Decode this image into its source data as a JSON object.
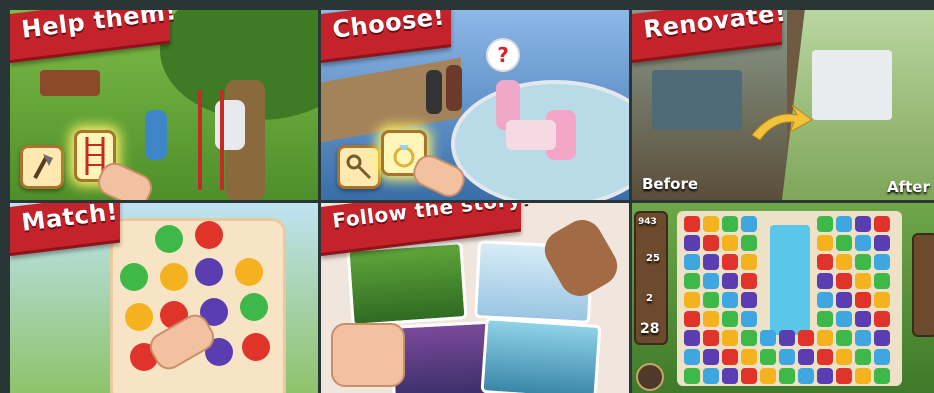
{
  "panels": [
    {
      "title": "Help them!"
    },
    {
      "title": "Choose!"
    },
    {
      "title": "Renovate!",
      "before_label": "Before",
      "after_label": "After"
    },
    {
      "title": "Match!"
    },
    {
      "title": "Follow the story!"
    },
    {
      "moves_label": "943",
      "counter_a": "25",
      "counter_b": "2",
      "moves": "28"
    }
  ],
  "colors": {
    "banner": "#c4232b",
    "banner_edge": "#8f141a",
    "divider": "#2a3535"
  },
  "icons": {
    "help": [
      "axe-icon",
      "ladder-icon"
    ],
    "choose": [
      "keys-icon",
      "ring-icon"
    ],
    "match_tiles": [
      "leaf-icon",
      "apple-icon",
      "pear-icon",
      "grape-icon"
    ]
  }
}
